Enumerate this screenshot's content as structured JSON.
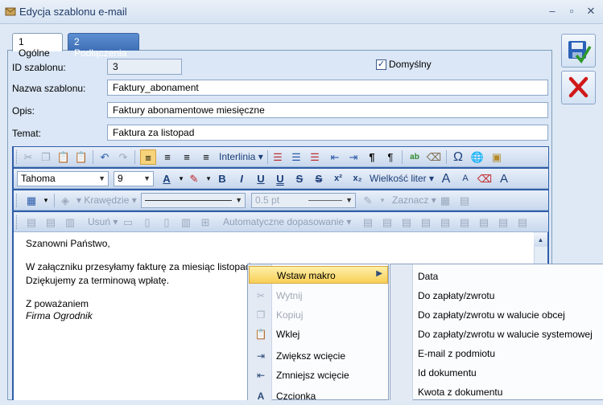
{
  "window": {
    "title": "Edycja szablonu e-mail",
    "minimize_glyph": "–",
    "maximize_glyph": "▫",
    "close_glyph": "✕"
  },
  "tabs": [
    {
      "label": "1 Ogólne",
      "active": true
    },
    {
      "label": "2 Podłączenia",
      "active": false
    }
  ],
  "form": {
    "id_label": "ID szablonu:",
    "id_value": "3",
    "default_label": "Domyślny",
    "default_checked": true,
    "name_label": "Nazwa szablonu:",
    "name_value": "Faktury_abonament",
    "desc_label": "Opis:",
    "desc_value": "Faktury abonamentowe miesięczne",
    "subject_label": "Temat:",
    "subject_value": "Faktura za listopad"
  },
  "toolbar": {
    "line_spacing_label": "Interlinia",
    "font_name": "Tahoma",
    "font_size": "9",
    "case_label": "Wielkość liter",
    "borders_label": "Krawędzie",
    "border_width": "0.5 pt",
    "select_label": "Zaznacz",
    "delete_label": "Usuń",
    "autofit_label": "Automatyczne dopasowanie",
    "bold": "B",
    "italic": "I",
    "underline": "U",
    "double_underline": "U",
    "strike": "S",
    "double_strike": "S",
    "superscript": "x²",
    "subscript": "x₂",
    "paragraph_mark": "¶",
    "omega": "Ω"
  },
  "document": {
    "lines": [
      "Szanowni Państwo,",
      "W załączniku przesyłamy fakturę za miesiąc listopad",
      "Dziękujemy za terminową wpłatę.",
      "Z poważaniem",
      "Firma Ogrodnik"
    ]
  },
  "context_menu": {
    "items": [
      {
        "label": "Wstaw makro",
        "icon": "",
        "state": "highlighted",
        "submenu": true
      },
      {
        "label": "Wytnij",
        "icon": "scissors-icon",
        "state": "disabled"
      },
      {
        "label": "Kopiuj",
        "icon": "copy-icon",
        "state": "disabled"
      },
      {
        "label": "Wklej",
        "icon": "paste-icon",
        "state": "normal"
      },
      {
        "label": "Zwiększ wcięcie",
        "icon": "indent-increase-icon",
        "state": "normal"
      },
      {
        "label": "Zmniejsz wcięcie",
        "icon": "indent-decrease-icon",
        "state": "normal"
      },
      {
        "label": "Czcionka",
        "icon": "font-icon",
        "state": "normal"
      }
    ]
  },
  "submenu": {
    "items": [
      "Data",
      "Do zapłaty/zwrotu",
      "Do zapłaty/zwrotu w walucie obcej",
      "Do zapłaty/zwrotu w walucie systemowej",
      "E-mail z podmiotu",
      "Id dokumentu",
      "Kwota z dokumentu"
    ]
  },
  "colors": {
    "accent": "#2f5ea8",
    "highlight": "#f7cf57",
    "panel": "#dbe7f6",
    "save_icon": "#2a62b8",
    "cancel_icon": "#d01818"
  }
}
